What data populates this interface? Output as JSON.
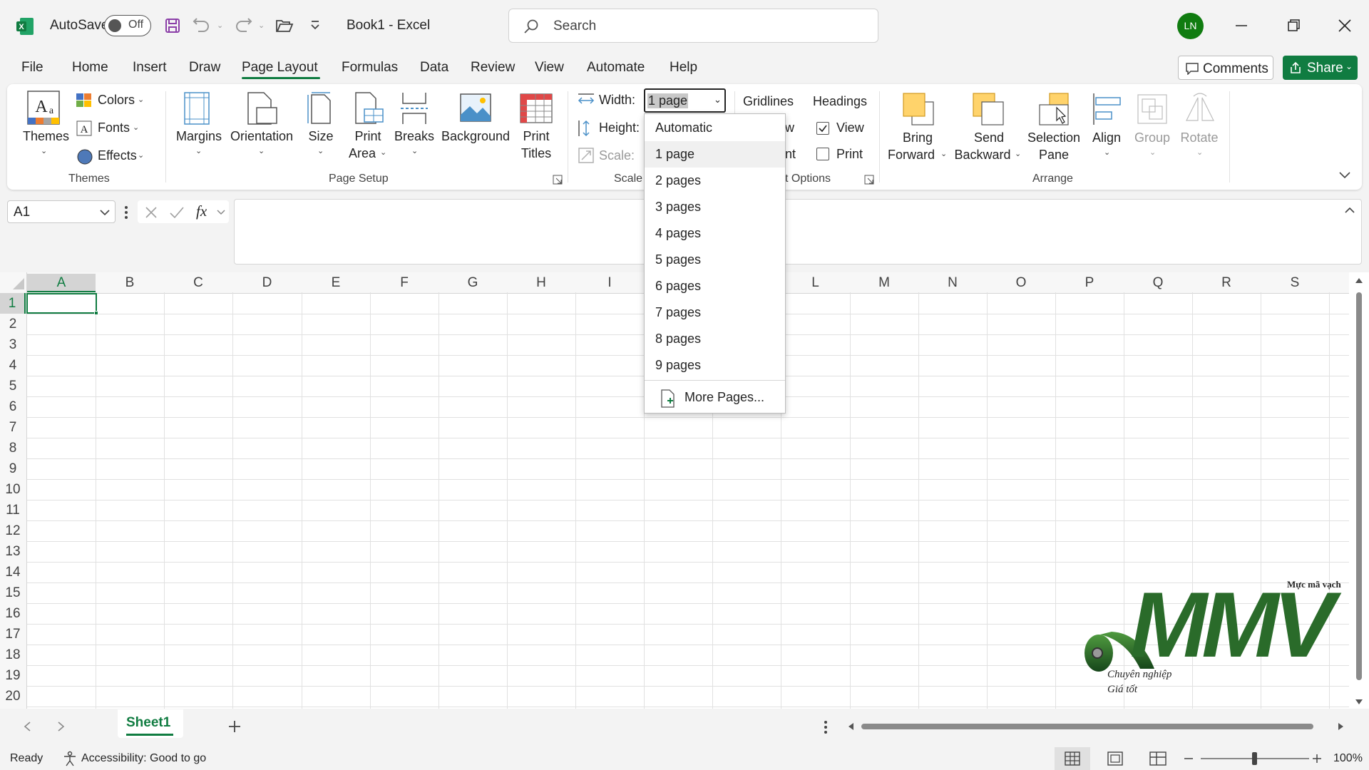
{
  "titlebar": {
    "autosave_label": "AutoSave",
    "autosave_state": "Off",
    "document_title": "Book1  -  Excel",
    "search_placeholder": "Search",
    "user_initials": "LN"
  },
  "menu": {
    "tabs": [
      "File",
      "Home",
      "Insert",
      "Draw",
      "Page Layout",
      "Formulas",
      "Data",
      "Review",
      "View",
      "Automate",
      "Help"
    ],
    "active_tab": "Page Layout",
    "comments_label": "Comments",
    "share_label": "Share"
  },
  "ribbon": {
    "themes": {
      "themes_label": "Themes",
      "colors_label": "Colors",
      "fonts_label": "Fonts",
      "effects_label": "Effects",
      "group_label": "Themes"
    },
    "page_setup": {
      "margins": "Margins",
      "orientation": "Orientation",
      "size": "Size",
      "print_area_1": "Print",
      "print_area_2": "Area",
      "breaks": "Breaks",
      "background": "Background",
      "print_titles_1": "Print",
      "print_titles_2": "Titles",
      "group_label": "Page Setup"
    },
    "scale": {
      "width_label": "Width:",
      "width_value": "1 page",
      "height_label": "Height:",
      "scale_label": "Scale:",
      "group_label": "Scale"
    },
    "sheet_options": {
      "gridlines": "Gridlines",
      "headings": "Headings",
      "view_label": "View",
      "print_label": "Print",
      "gridlines_view_partial": "w",
      "gridlines_print_partial": "nt",
      "group_label_partial": "t Options",
      "headings_view_checked": true,
      "headings_print_checked": false
    },
    "arrange": {
      "bring_forward_1": "Bring",
      "bring_forward_2": "Forward",
      "send_backward_1": "Send",
      "send_backward_2": "Backward",
      "selection_pane_1": "Selection",
      "selection_pane_2": "Pane",
      "align": "Align",
      "group": "Group",
      "rotate": "Rotate",
      "group_label": "Arrange"
    }
  },
  "formula_bar": {
    "name_box": "A1",
    "fx": "fx",
    "formula": ""
  },
  "grid": {
    "columns": [
      "A",
      "B",
      "C",
      "D",
      "E",
      "F",
      "G",
      "H",
      "I",
      "J",
      "K",
      "L",
      "M",
      "N",
      "O",
      "P",
      "Q",
      "R",
      "S"
    ],
    "rows": [
      "1",
      "2",
      "3",
      "4",
      "5",
      "6",
      "7",
      "8",
      "9",
      "10",
      "11",
      "12",
      "13",
      "14",
      "15",
      "16",
      "17",
      "18",
      "19",
      "20"
    ],
    "active_cell": "A1"
  },
  "dropdown": {
    "items": [
      "Automatic",
      "1 page",
      "2 pages",
      "3 pages",
      "4 pages",
      "5 pages",
      "6 pages",
      "7 pages",
      "8 pages",
      "9 pages"
    ],
    "selected": "1 page",
    "more_label": "More Pages..."
  },
  "watermark": {
    "top_text": "Mực mã vạch",
    "brand": "MMV",
    "line1": "Chuyên nghiệp",
    "line2": "Giá tốt"
  },
  "sheets": {
    "tabs": [
      "Sheet1"
    ],
    "active": "Sheet1"
  },
  "status": {
    "ready": "Ready",
    "accessibility": "Accessibility: Good to go",
    "zoom": "100%"
  },
  "colors": {
    "accent": "#107c41",
    "excel_green": "#217346"
  }
}
